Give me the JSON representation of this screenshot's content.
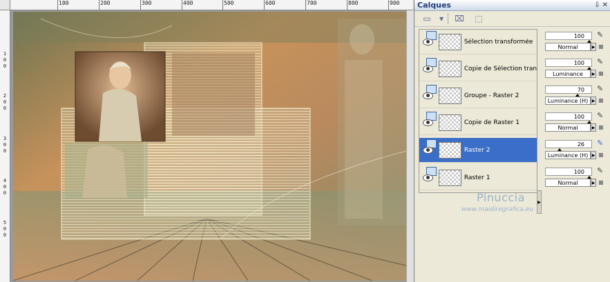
{
  "rulers": {
    "top": [
      "100",
      "200",
      "300",
      "400",
      "500",
      "600",
      "700",
      "800",
      "900"
    ],
    "left": [
      [
        "1",
        "0",
        "0"
      ],
      [
        "2",
        "0",
        "0"
      ],
      [
        "3",
        "0",
        "0"
      ],
      [
        "4",
        "0",
        "0"
      ],
      [
        "5",
        "0",
        "0"
      ]
    ]
  },
  "panel": {
    "title": "Calques",
    "pin": "⇩ ✕"
  },
  "toolbar": [
    "new-layer-icon",
    "dropdown-icon",
    "delete-layer-icon",
    "mask-icon"
  ],
  "layers": [
    {
      "name": "Sélection transformée",
      "selected": false
    },
    {
      "name": "Copie de Sélection transf",
      "selected": false
    },
    {
      "name": "Groupe - Raster 2",
      "selected": false
    },
    {
      "name": "Copie de Raster 1",
      "selected": false
    },
    {
      "name": "Raster 2",
      "selected": true
    },
    {
      "name": "Raster 1",
      "selected": false
    }
  ],
  "props": [
    {
      "opacity": "100",
      "blend": "Normal",
      "opacity_level": 1.0
    },
    {
      "opacity": "100",
      "blend": "Luminance",
      "opacity_level": 1.0
    },
    {
      "opacity": "70",
      "blend": "Luminance (H)",
      "opacity_level": 0.7
    },
    {
      "opacity": "100",
      "blend": "Normal",
      "opacity_level": 1.0
    },
    {
      "opacity": "26",
      "blend": "Luminance (H)",
      "opacity_level": 0.26
    },
    {
      "opacity": "100",
      "blend": "Normal",
      "opacity_level": 1.0
    }
  ],
  "watermark": {
    "name": "Pinuccia",
    "url": "www.maidiregrafica.eu"
  },
  "colors": {
    "selection": "#3a6ec8",
    "panel_bg": "#ece9d8",
    "watermark": "#9ab3cc"
  }
}
